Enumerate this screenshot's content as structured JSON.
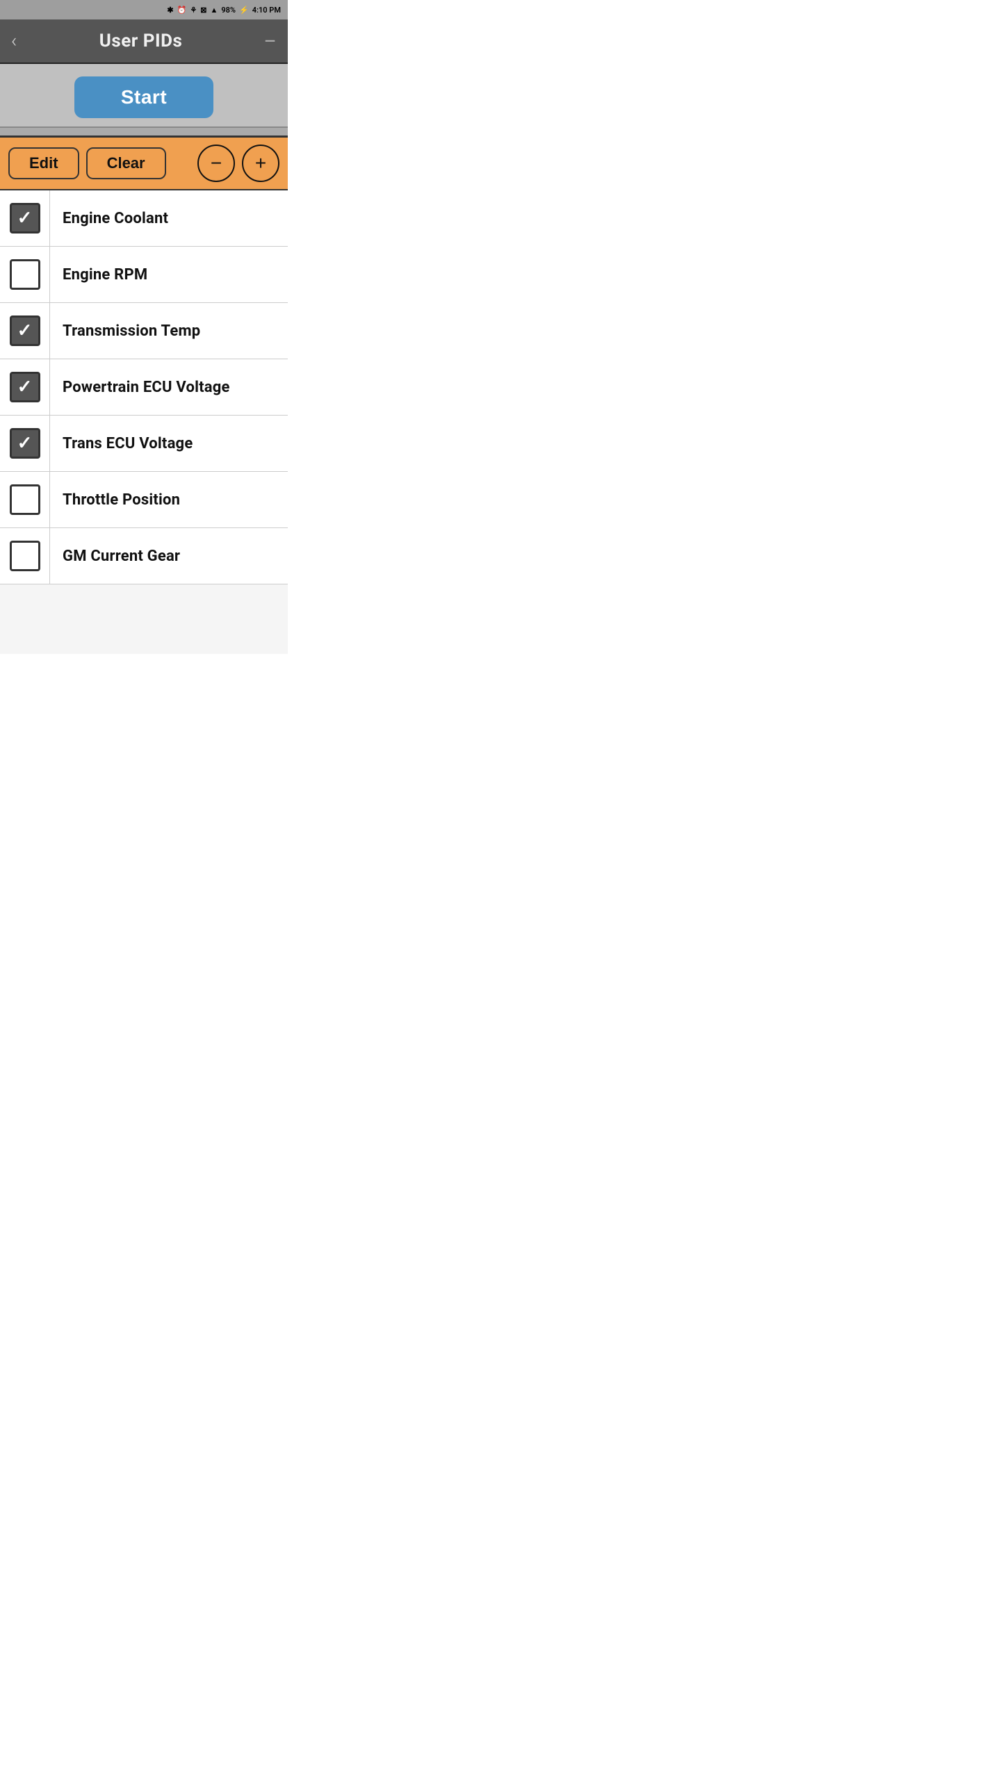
{
  "statusBar": {
    "battery": "98%",
    "time": "4:10 PM"
  },
  "header": {
    "backLabel": "‹",
    "title": "User PIDs",
    "menuLabel": "—"
  },
  "startButton": {
    "label": "Start"
  },
  "toolbar": {
    "editLabel": "Edit",
    "clearLabel": "Clear",
    "minusLabel": "−",
    "plusLabel": "+"
  },
  "pidItems": [
    {
      "id": 1,
      "label": "Engine Coolant",
      "checked": true
    },
    {
      "id": 2,
      "label": "Engine RPM",
      "checked": false
    },
    {
      "id": 3,
      "label": "Transmission Temp",
      "checked": true
    },
    {
      "id": 4,
      "label": "Powertrain ECU Voltage",
      "checked": true
    },
    {
      "id": 5,
      "label": "Trans ECU Voltage",
      "checked": true
    },
    {
      "id": 6,
      "label": "Throttle Position",
      "checked": false
    },
    {
      "id": 7,
      "label": "GM Current Gear",
      "checked": false
    }
  ]
}
